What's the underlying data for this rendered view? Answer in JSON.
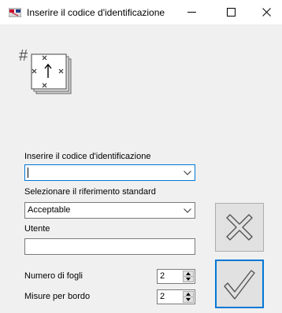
{
  "window": {
    "title": "Inserire il codice d'identificazione",
    "minimize_glyph": "—",
    "maximize_glyph": "☐",
    "close_glyph": "✕"
  },
  "form": {
    "id_code": {
      "label": "Inserire il codice d'identificazione",
      "value": ""
    },
    "standard_reference": {
      "label": "Selezionare il riferimento standard",
      "value": "Acceptable"
    },
    "user": {
      "label": "Utente",
      "value": ""
    },
    "sheet_count": {
      "label": "Numero di fogli",
      "value": "2"
    },
    "measures_per_edge": {
      "label": "Misure per bordo",
      "value": "2"
    }
  },
  "icons": {
    "app": "app-flag-icon",
    "header": "sheet-id-measure-icon",
    "cancel": "x-icon",
    "ok": "check-icon"
  },
  "colors": {
    "focus_border": "#0078d7",
    "dialog_bg": "#f0f0f0",
    "button_bg": "#e1e1e1"
  }
}
